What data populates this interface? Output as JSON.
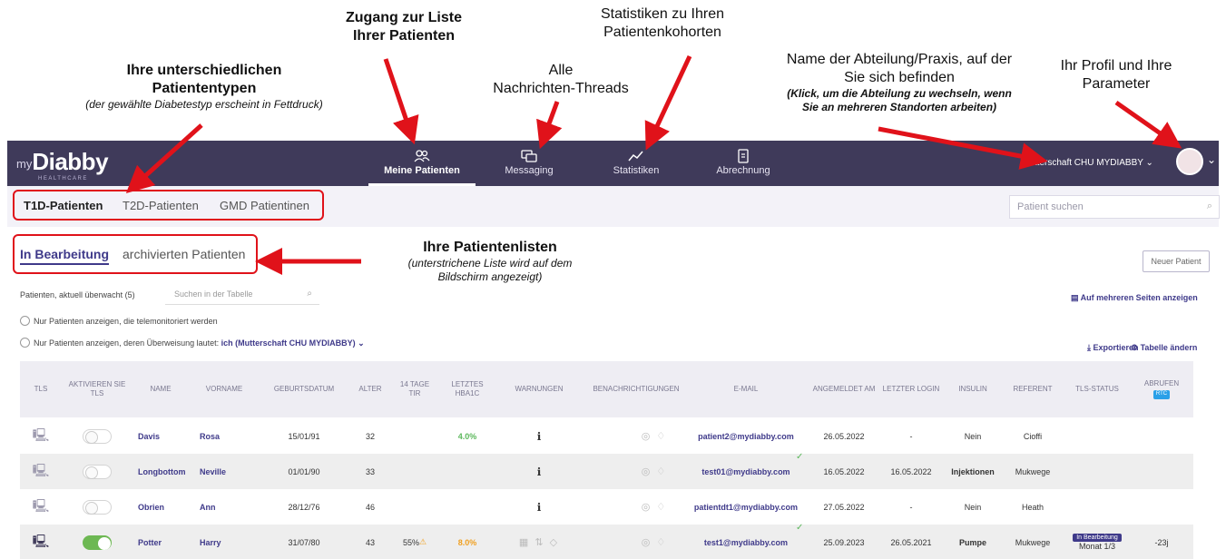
{
  "annotations": {
    "liste": {
      "line1": "Zugang zur Liste",
      "line2": "Ihrer Patienten"
    },
    "statistik": {
      "line1": "Statistiken zu Ihren",
      "line2": "Patientenkohorten"
    },
    "threads": {
      "line1": "Alle",
      "line2": "Nachrichten-Threads"
    },
    "typen": {
      "line1": "Ihre unterschiedlichen",
      "line2": "Patiententypen",
      "sub": "(der gewählte Diabetestyp erscheint in Fettdruck)"
    },
    "abteilung": {
      "line1": "Name der Abteilung/Praxis, auf der",
      "line2": "Sie sich befinden",
      "sub1": "(Klick, um die Abteilung zu wechseln, wenn",
      "sub2": "Sie an mehreren Standorten arbeiten)"
    },
    "profil": {
      "line1": "Ihr Profil und Ihre",
      "line2": "Parameter"
    },
    "listen": {
      "line1": "Ihre Patientenlisten",
      "sub1": "(unterstrichene Liste wird auf dem",
      "sub2": "Bildschirm angezeigt)"
    }
  },
  "colors": {
    "navbar": "#3f3a5a",
    "accent": "#3f3a8a",
    "annotation": "#e0121a",
    "toggle_on": "#6db853"
  },
  "navbar": {
    "logo_prefix": "my",
    "logo": "Diabby",
    "logo_sub": "HEALTHCARE",
    "items": [
      {
        "label": "Meine Patienten",
        "icon": "patients-icon",
        "active": true
      },
      {
        "label": "Messaging",
        "icon": "messages-icon",
        "active": false
      },
      {
        "label": "Statistiken",
        "icon": "chart-line-icon",
        "active": false
      },
      {
        "label": "Abrechnung",
        "icon": "document-icon",
        "active": false
      }
    ],
    "department": "Mutterschaft CHU MYDIABBY ⌄",
    "avatar_chevron": "⌄"
  },
  "patient_types": [
    "T1D-Patienten",
    "T2D-Patienten",
    "GMD Patientinen"
  ],
  "patient_search_placeholder": "Patient suchen",
  "list_tabs": [
    "In Bearbeitung",
    "archivierten Patienten"
  ],
  "new_patient_button": "Neuer Patient",
  "monitored_count": "Patienten, aktuell überwacht (5)",
  "table_search_placeholder": "Suchen in der Tabelle",
  "multi_page_link": "Auf mehreren Seiten anzeigen",
  "filter1": "Nur Patienten anzeigen, die telemonitoriert werden",
  "filter2_prefix": "Nur Patienten anzeigen, deren Überweisung lautet:",
  "filter2_value": "ich (Mutterschaft CHU MYDIABBY) ⌄",
  "export_label": "Exportieren",
  "change_table_label": "Tabelle ändern",
  "columns": [
    "TLS",
    "AKTIVIEREN SIE TLS",
    "NAME",
    "VORNAME",
    "GEBURTSDATUM",
    "ALTER",
    "14 TAGE TIR",
    "LETZTES HBA1C",
    "WARNUNGEN",
    "BENACHRICHTIGUNGEN",
    "E-MAIL",
    "ANGEMELDET AM",
    "LETZTER LOGIN",
    "INSULIN",
    "REFERENT",
    "TLS-STATUS",
    "ABRUFEN"
  ],
  "rtc_badge": "RTC",
  "rows": [
    {
      "name": "Davis",
      "firstname": "Rosa",
      "birth": "15/01/91",
      "age": "32",
      "tir": "",
      "hba1c": "4.0%",
      "email": "patient2@mydiabby.com",
      "registered": "26.05.2022",
      "last_login": "-",
      "insulin": "Nein",
      "referent": "Cioffi",
      "tls_badge": "",
      "tls_sub": "",
      "retrieve": "",
      "tls_on": false
    },
    {
      "name": "Longbottom",
      "firstname": "Neville",
      "birth": "01/01/90",
      "age": "33",
      "tir": "",
      "hba1c": "",
      "email": "test01@mydiabby.com",
      "registered": "16.05.2022",
      "last_login": "16.05.2022",
      "insulin": "Injektionen",
      "referent": "Mukwege",
      "tls_badge": "",
      "tls_sub": "",
      "retrieve": "",
      "tls_on": false
    },
    {
      "name": "Obrien",
      "firstname": "Ann",
      "birth": "28/12/76",
      "age": "46",
      "tir": "",
      "hba1c": "",
      "email": "patientdt1@mydiabby.com",
      "registered": "27.05.2022",
      "last_login": "-",
      "insulin": "Nein",
      "referent": "Heath",
      "tls_badge": "",
      "tls_sub": "",
      "retrieve": "",
      "tls_on": false
    },
    {
      "name": "Potter",
      "firstname": "Harry",
      "birth": "31/07/80",
      "age": "43",
      "tir": "55%",
      "hba1c": "8.0%",
      "email": "test1@mydiabby.com",
      "registered": "25.09.2023",
      "last_login": "26.05.2021",
      "insulin": "Pumpe",
      "referent": "Mukwege",
      "tls_badge": "In Bearbeitung",
      "tls_sub": "Monat 1/3",
      "retrieve": "-23j",
      "tls_on": true
    }
  ]
}
